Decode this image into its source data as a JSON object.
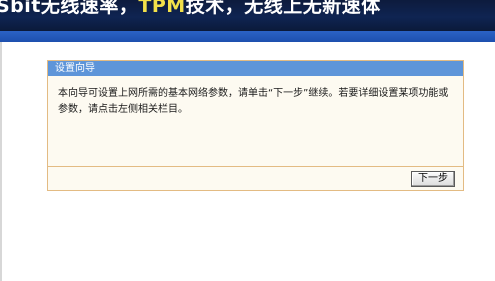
{
  "banner": {
    "text_part1": "Sbit无线速率，",
    "text_highlight": "TPM",
    "text_part2": "技术，无线上无新速体"
  },
  "wizard": {
    "title": "设置向导",
    "description": "本向导可设置上网所需的基本网络参数，请单击“下一步”继续。若要详细设置某项功能或参数，请点击左侧相关栏目。",
    "next_label": "下一步"
  },
  "colors": {
    "banner_bg": "#0f2452",
    "banner_strip": "#2b63c6",
    "panel_header": "#5e95d9",
    "panel_border": "#e3bb83",
    "panel_bg": "#fdfaf1"
  }
}
